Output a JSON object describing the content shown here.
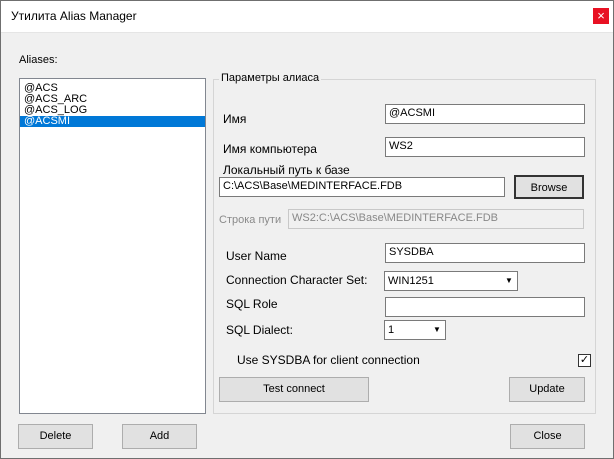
{
  "window": {
    "title": "Утилита Alias Manager",
    "close_glyph": "×"
  },
  "aliases": {
    "label": "Aliases:",
    "items": [
      "@ACS",
      "@ACS_ARC",
      "@ACS_LOG",
      "@ACSMI"
    ],
    "selected_index": 3
  },
  "params": {
    "group_title": "Параметры алиаса",
    "name_label": "Имя",
    "name_value": "@ACSMI",
    "computer_label": "Имя компьютера",
    "computer_value": "WS2",
    "local_path_label": "Локальный путь к базе",
    "local_path_value": "C:\\ACS\\Base\\MEDINTERFACE.FDB",
    "browse_label": "Browse",
    "path_string_label": "Строка пути",
    "path_string_value": "WS2:C:\\ACS\\Base\\MEDINTERFACE.FDB",
    "user_name_label": "User Name",
    "user_name_value": "SYSDBA",
    "charset_label": "Connection Character Set:",
    "charset_value": "WIN1251",
    "sql_role_label": "SQL Role",
    "sql_role_value": "",
    "sql_dialect_label": "SQL Dialect:",
    "sql_dialect_value": "1",
    "use_sysdba_label": "Use SYSDBA for client connection",
    "use_sysdba_checked": "✓",
    "test_connect_label": "Test connect",
    "update_label": "Update"
  },
  "footer": {
    "delete_label": "Delete",
    "add_label": "Add",
    "close_label": "Close"
  }
}
